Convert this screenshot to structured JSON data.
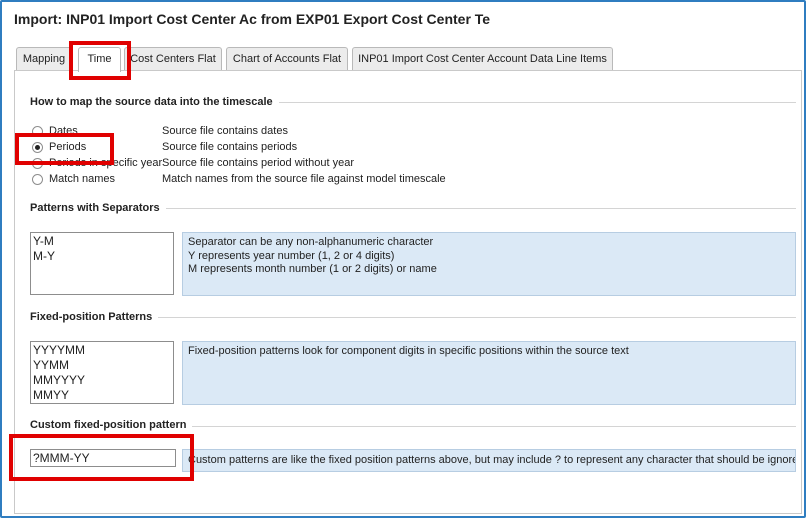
{
  "window": {
    "title": "Import: INP01 Import Cost Center Ac from EXP01 Export Cost Center Te"
  },
  "tabs": [
    {
      "label": "Mapping",
      "active": false
    },
    {
      "label": "Time",
      "active": true
    },
    {
      "label": "Cost Centers Flat",
      "active": false
    },
    {
      "label": "Chart of Accounts Flat",
      "active": false
    },
    {
      "label": "INP01 Import Cost Center Account Data Line Items",
      "active": false
    }
  ],
  "timescale": {
    "title": "How to map the source data into the timescale",
    "options": [
      {
        "label": "Dates",
        "description": "Source file contains dates",
        "checked": false
      },
      {
        "label": "Periods",
        "description": "Source file contains periods",
        "checked": true
      },
      {
        "label": "Periods in specific year",
        "description": "Source file contains period without year",
        "checked": false
      },
      {
        "label": "Match names",
        "description": "Match names from the source file against model timescale",
        "checked": false
      }
    ]
  },
  "separators": {
    "title": "Patterns with Separators",
    "patterns": [
      "Y-M",
      "M-Y"
    ],
    "info": [
      "Separator can be any non-alphanumeric character",
      "Y represents year number (1, 2 or 4 digits)",
      "M represents month number (1 or 2 digits) or name"
    ]
  },
  "fixed": {
    "title": "Fixed-position Patterns",
    "patterns": [
      "YYYYMM",
      "YYMM",
      "MMYYYY",
      "MMYY"
    ],
    "info": "Fixed-position patterns look for component digits in specific positions within the source text"
  },
  "custom": {
    "title": "Custom fixed-position pattern",
    "value": "?MMM-YY",
    "info": "Custom patterns are like the fixed position patterns above, but may include ? to represent any character that should be ignored"
  },
  "colors": {
    "frame_border": "#2f7dc0",
    "highlight": "#e00000",
    "info_background": "#dbe9f6"
  }
}
